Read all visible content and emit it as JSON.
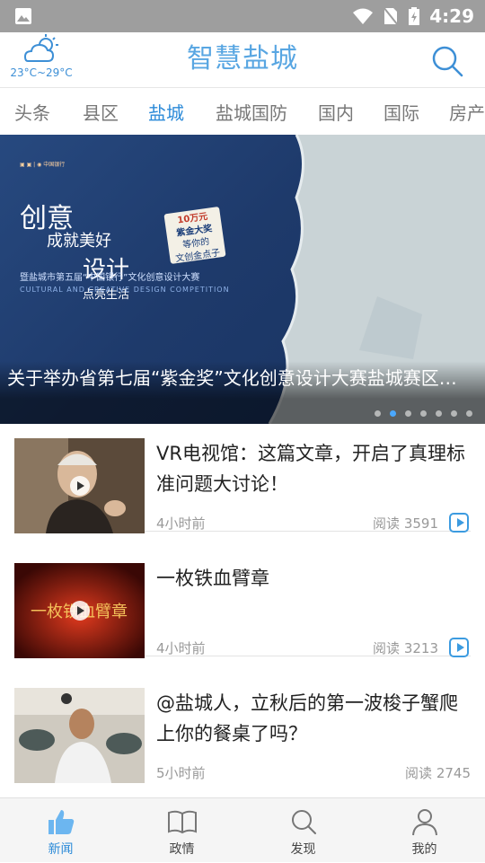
{
  "status_bar": {
    "time": "4:29"
  },
  "header": {
    "weather_temp": "23°C~29°C",
    "logo": "智慧盐城"
  },
  "tabs": [
    {
      "label": "头条"
    },
    {
      "label": "县区"
    },
    {
      "label": "盐城",
      "active": true
    },
    {
      "label": "盐城国防"
    },
    {
      "label": "国内"
    },
    {
      "label": "国际"
    },
    {
      "label": "房产"
    }
  ],
  "banner": {
    "caption": "关于举办省第七届“紫金奖”文化创意设计大赛盐城赛区…",
    "poster_line1": "创意",
    "poster_line2": "成就美好",
    "poster_line3": "设计",
    "poster_line4": "点亮生活",
    "poster_sub": "暨盐城市第五届“中国银行”文化创意设计大赛",
    "poster_en": "CULTURAL AND CREATIVE DESIGN COMPETITION",
    "badge_line1": "10万元",
    "badge_line2": "紫金大奖",
    "badge_line3": "等你的",
    "badge_line4": "文创金点子",
    "dots_total": 7,
    "dot_active_index": 1
  },
  "articles": [
    {
      "title": "VR电视馆：这篇文章，开启了真理标准问题大讨论！",
      "time": "4小时前",
      "reads": "阅读 3591",
      "video": true
    },
    {
      "title": "一枚铁血臂章",
      "time": "4小时前",
      "reads": "阅读 3213",
      "video": true
    },
    {
      "title": "@盐城人，立秋后的第一波梭子蟹爬上你的餐桌了吗？",
      "time": "5小时前",
      "reads": "阅读 2745",
      "video": false
    }
  ],
  "bottom_nav": [
    {
      "label": "新闻",
      "active": true,
      "icon": "thumbs-up-icon"
    },
    {
      "label": "政情",
      "active": false,
      "icon": "book-icon"
    },
    {
      "label": "发现",
      "active": false,
      "icon": "search-icon"
    },
    {
      "label": "我的",
      "active": false,
      "icon": "person-icon"
    }
  ],
  "colors": {
    "accent": "#2b8ad8",
    "status_bar": "#9e9e9e"
  }
}
